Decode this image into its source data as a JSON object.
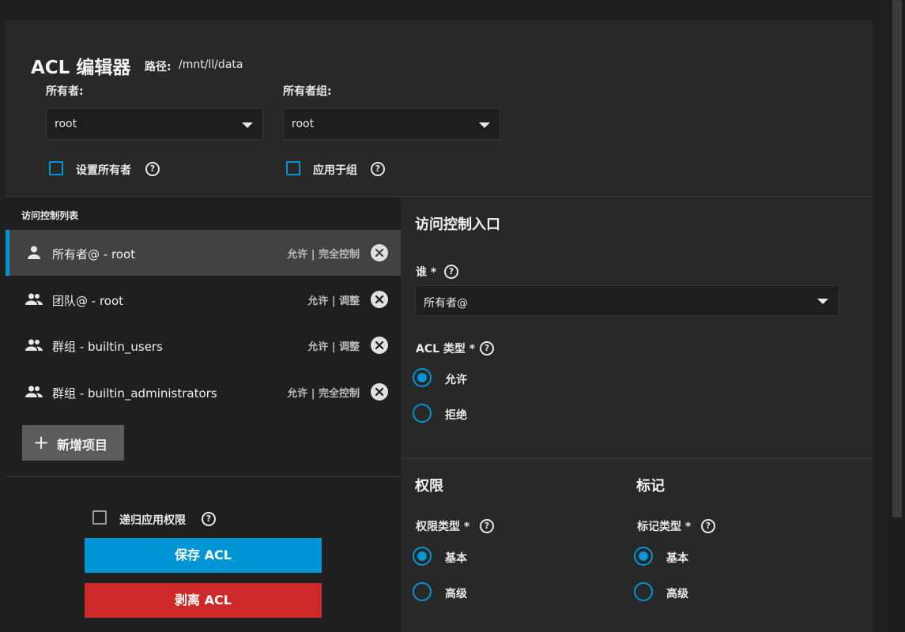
{
  "header": {
    "title": "ACL 编辑器",
    "path_label": "路径:",
    "path_value": "/mnt/ll/data"
  },
  "owner": {
    "label": "所有者:",
    "value": "root",
    "checkbox_label": "设置所有者"
  },
  "owner_group": {
    "label": "所有者组:",
    "value": "root",
    "checkbox_label": "应用于组"
  },
  "acl_list": {
    "title": "访问控制列表",
    "items": [
      {
        "icon": "person-icon",
        "name": "所有者@ - root",
        "permission": "允许 | 完全控制"
      },
      {
        "icon": "group-icon",
        "name": "团队@ - root",
        "permission": "允许 | 调整"
      },
      {
        "icon": "group-icon",
        "name": "群组 - builtin_users",
        "permission": "允许 | 调整"
      },
      {
        "icon": "group-icon",
        "name": "群组 - builtin_administrators",
        "permission": "允许 | 完全控制"
      }
    ],
    "add_button": "新增项目",
    "selected_index": 0
  },
  "bottom_actions": {
    "recursive_label": "递归应用权限",
    "save_label": "保存 ACL",
    "strip_label": "剥离 ACL"
  },
  "entry": {
    "title": "访问控制入口",
    "who_label": "谁",
    "who_required": "*",
    "who_value": "所有者@",
    "acl_type_label": "ACL 类型",
    "acl_type_required": "*",
    "acl_type_options": [
      "允许",
      "拒绝"
    ],
    "acl_type_selected": "允许"
  },
  "permissions": {
    "title": "权限",
    "type_label": "权限类型",
    "required": "*",
    "options": [
      "基本",
      "高级"
    ],
    "selected": "基本"
  },
  "flags": {
    "title": "标记",
    "type_label": "标记类型",
    "required": "*",
    "options": [
      "基本",
      "高级"
    ],
    "selected": "基本"
  },
  "colors": {
    "accent": "#0095d5",
    "danger": "#ce2929",
    "panel": "#282828",
    "background": "#1f1f1f"
  }
}
